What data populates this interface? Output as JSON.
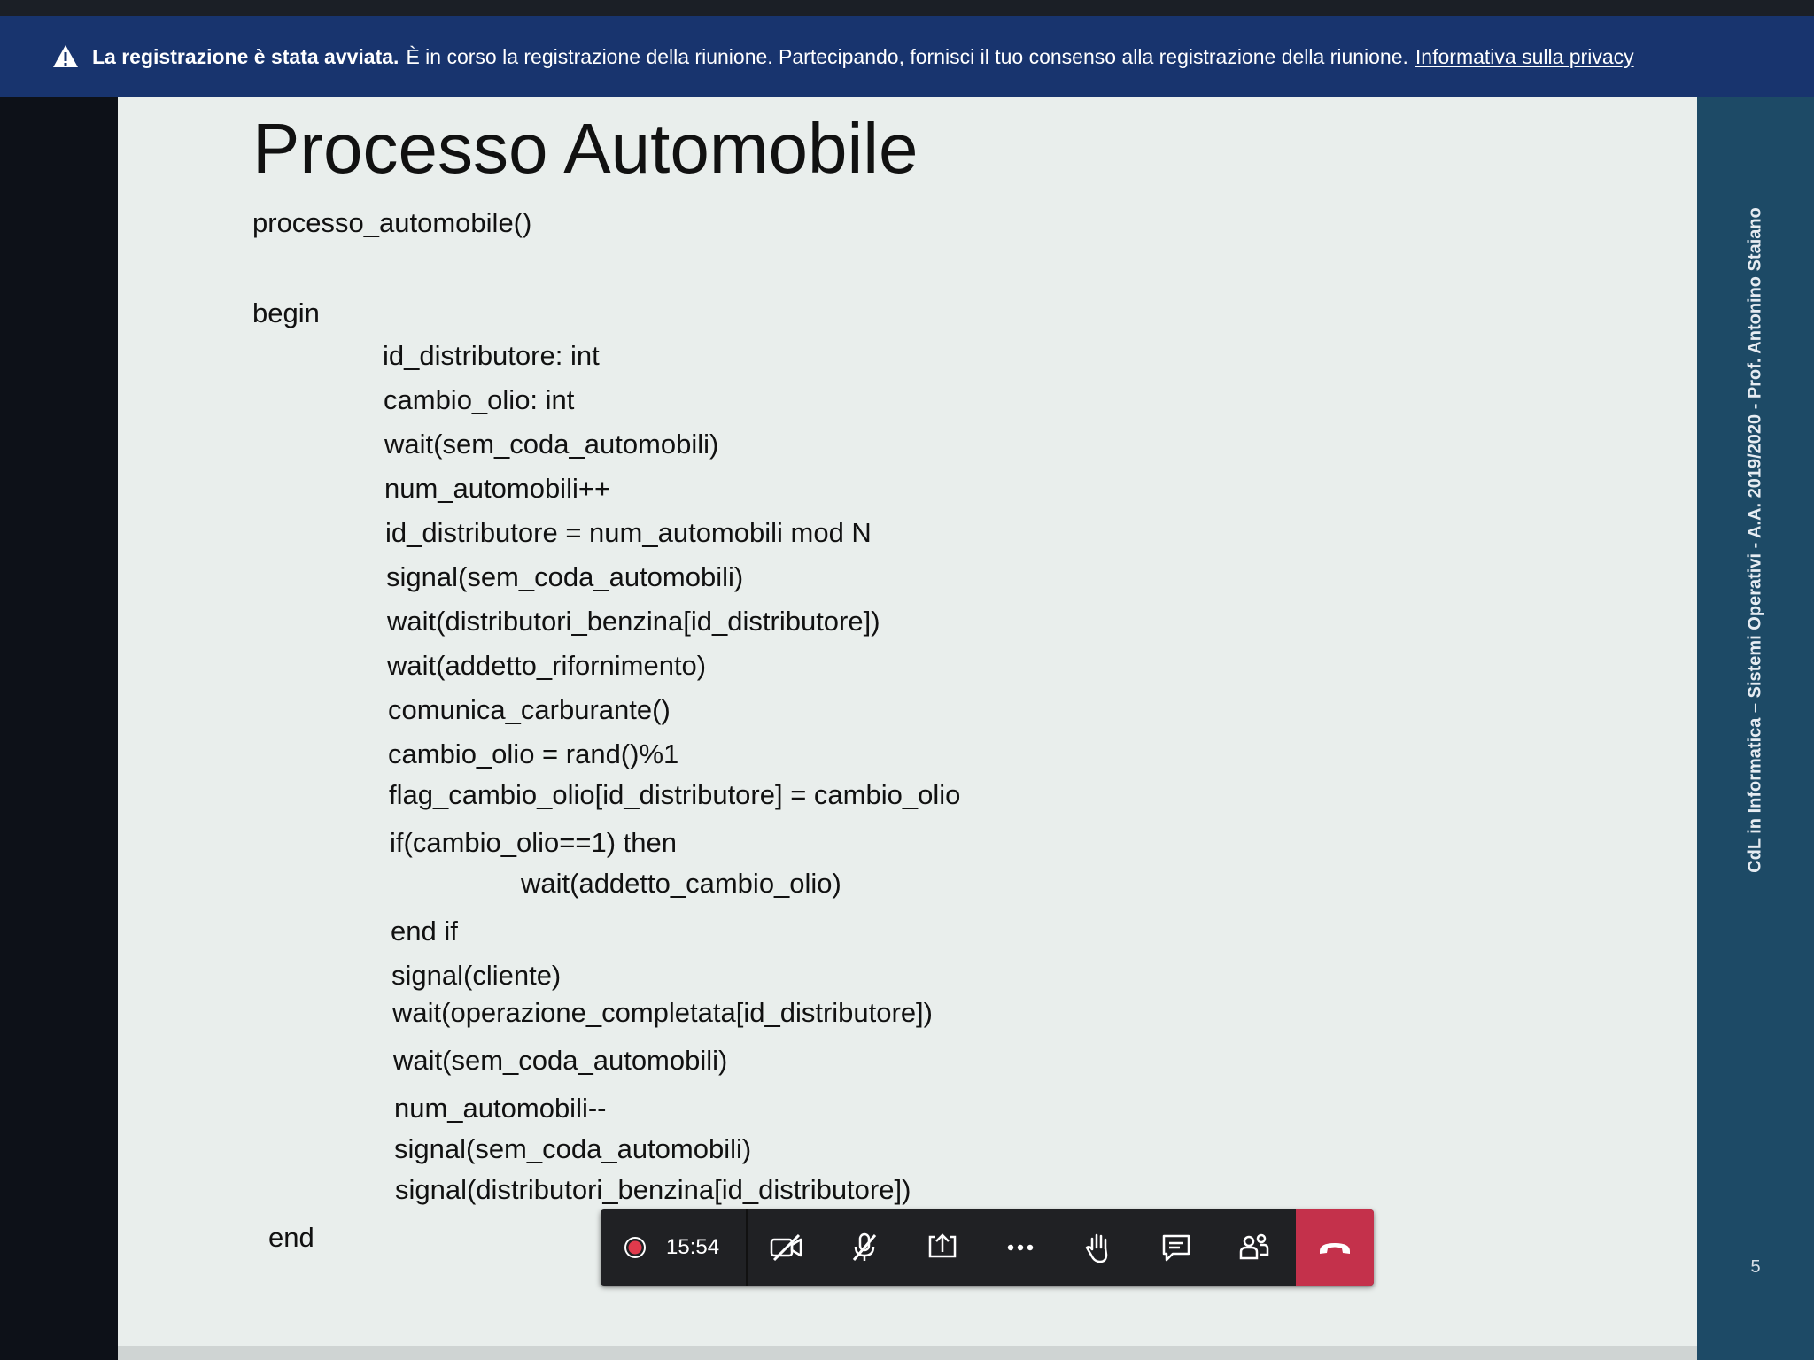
{
  "banner": {
    "bold_text": "La registrazione è stata avviata.",
    "text": "È in corso la registrazione della riunione. Partecipando, fornisci il tuo consenso alla registrazione della riunione.",
    "link_text": "Informativa sulla privacy"
  },
  "slide": {
    "title": "Processo Automobile",
    "code_lines": [
      "processo_automobile()",
      "begin",
      "id_distributore: int",
      "cambio_olio: int",
      "wait(sem_coda_automobili)",
      "num_automobili++",
      "id_distributore = num_automobili mod N",
      "signal(sem_coda_automobili)",
      "wait(distributori_benzina[id_distributore])",
      "wait(addetto_rifornimento)",
      "comunica_carburante()",
      "cambio_olio = rand()%1",
      "flag_cambio_olio[id_distributore] = cambio_olio",
      "if(cambio_olio==1) then",
      "wait(addetto_cambio_olio)",
      "end if",
      "signal(cliente)",
      "wait(operazione_completata[id_distributore])",
      "wait(sem_coda_automobili)",
      "num_automobili--",
      "signal(sem_coda_automobili)",
      "signal(distributori_benzina[id_distributore])",
      "end"
    ],
    "sidebar_caption": "CdL in Informatica – Sistemi Operativi - A.A. 2019/2020 - Prof. Antonino Staiano",
    "page_number": "5"
  },
  "toolbar": {
    "timer": "15:54",
    "buttons": [
      {
        "name": "camera-off",
        "icon": "camera-off-icon"
      },
      {
        "name": "mic-off",
        "icon": "mic-off-icon"
      },
      {
        "name": "share",
        "icon": "share-screen-icon"
      },
      {
        "name": "more",
        "icon": "more-icon"
      },
      {
        "name": "raise-hand",
        "icon": "raise-hand-icon"
      },
      {
        "name": "chat",
        "icon": "chat-icon"
      },
      {
        "name": "participants",
        "icon": "participants-icon"
      }
    ],
    "hangup_icon": "hang-up-icon",
    "recording_icon": "recording-dot-icon",
    "hangup_color": "#c4314b"
  }
}
